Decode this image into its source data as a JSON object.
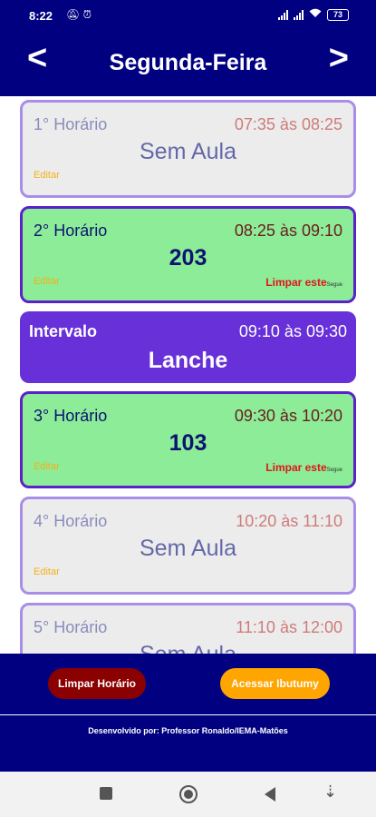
{
  "status_bar": {
    "time": "8:22",
    "battery": "73"
  },
  "header": {
    "prev_glyph": "<",
    "title": "Segunda-Feira",
    "next_glyph": ">"
  },
  "schedule": {
    "slots": [
      {
        "label": "1° Horário",
        "time": "07:35 às 08:25",
        "subject": "Sem Aula",
        "edit": "Editar"
      },
      {
        "label": "2° Horário",
        "time": "08:25 às 09:10",
        "subject": "203",
        "edit": "Editar",
        "clear": "Limpar este",
        "clear_sub": "Segue"
      },
      {
        "label": "Intervalo",
        "time": "09:10 às 09:30",
        "subject": "Lanche"
      },
      {
        "label": "3° Horário",
        "time": "09:30 às 10:20",
        "subject": "103",
        "edit": "Editar",
        "clear": "Limpar este",
        "clear_sub": "Segue"
      },
      {
        "label": "4° Horário",
        "time": "10:20 às 11:10",
        "subject": "Sem Aula",
        "edit": "Editar"
      },
      {
        "label": "5° Horário",
        "time": "11:10 às 12:00",
        "subject": "Sem Aula"
      }
    ]
  },
  "footer": {
    "clear_button": "Limpar Horário",
    "access_button": "Acessar Ibutumy",
    "credits": "Desenvolvido por: Professor Ronaldo/IEMA-Matões"
  },
  "icons": {
    "dnd": "bell-off-icon",
    "alarm": "alarm-icon",
    "wifi": "wifi-icon",
    "nav_square": "recent-apps-icon",
    "nav_circle": "home-icon",
    "nav_back": "back-icon",
    "nav_down": "keyboard-hide-icon"
  },
  "colors": {
    "header_bg": "#000080",
    "empty_card_bg": "#ececec",
    "active_card_bg": "#8cec98",
    "interval_bg": "#6730d8",
    "clear_button_bg": "#8b0000",
    "access_button_bg": "#ffa500"
  }
}
